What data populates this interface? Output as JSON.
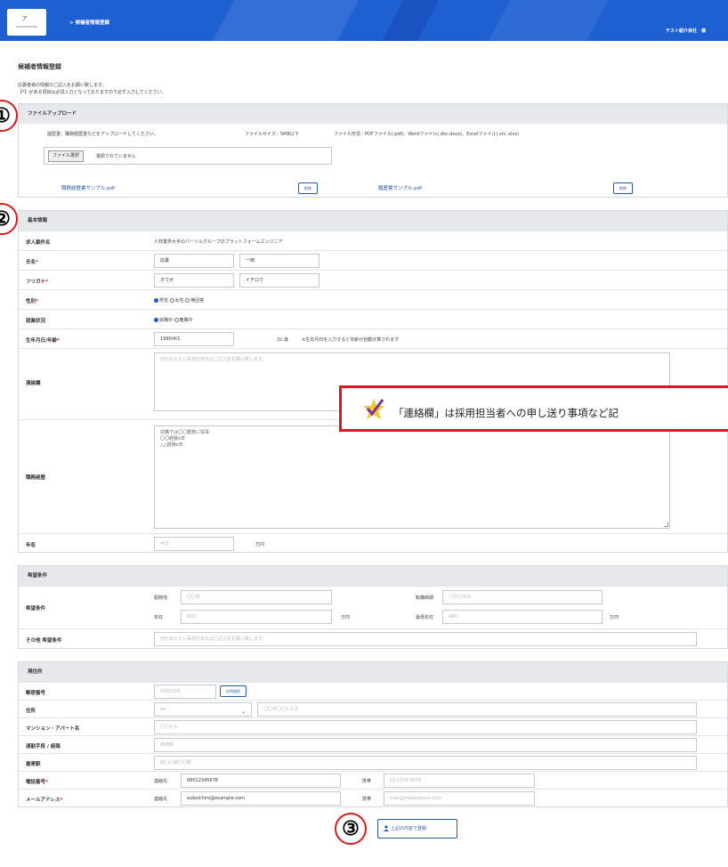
{
  "header": {
    "logo_text": "ア",
    "breadcrumb": "> 候補者情報登録",
    "company": "テスト紹介会社　様"
  },
  "page": {
    "title": "候補者情報登録",
    "intro_line1": "応募者様の情報のご記入をお願い致します。",
    "intro_line2": "【*】がある項目は必須入力となっておりますので必ず入力してください。"
  },
  "markers": [
    "①",
    "②",
    "③"
  ],
  "upload": {
    "section_title": "ファイルアップロード",
    "instruction": "履歴書、職務経歴書などをアップロードしてください。",
    "size_limit": "ファイルサイズ：5MB以下",
    "formats": "ファイル形式：PDFファイル(.pdf)、Wordファイル(.doc.docx)、Excelファイル(.xls .xlsx)",
    "choose_button": "ファイル選択",
    "no_file_text": "選択されていません",
    "files": [
      {
        "name": "職務経歴書サンプル.pdf",
        "delete_label": "削除"
      },
      {
        "name": "履歴書サンプル.pdf",
        "delete_label": "削除"
      }
    ]
  },
  "basic": {
    "section_title": "基本情報",
    "job_label": "求人案件名",
    "job_value": "人材業界大手のパーソルグループのプラットフォームエンジニア",
    "name_label": "氏名",
    "last_name": "応募",
    "first_name": "一郎",
    "kana_label": "フリガナ",
    "last_kana": "オウボ",
    "first_kana": "イチロウ",
    "gender_label": "性別",
    "gender_options": [
      "男性",
      "女性",
      "無回答"
    ],
    "gender_selected": "男性",
    "employment_label": "就業状況",
    "employment_options": [
      "就職中",
      "離職中"
    ],
    "employment_selected": "就職中",
    "birth_label": "生年月日/年齢",
    "birth_value": "1990/4/1",
    "age_value": "32",
    "age_unit": "歳",
    "age_note": "※生年月日を入力すると年齢が自動計算されます",
    "contact_label": "連絡欄",
    "contact_placeholder": "何か伝えたい事項があればご記入をお願い致します。",
    "career_label": "職務経歴",
    "career_lines": [
      "前職では〇〇業務に従事",
      "〇〇経験x年",
      "△△経験x年"
    ],
    "income_label": "年収",
    "income_placeholder": "400",
    "income_unit": "万円"
  },
  "callout": {
    "text": "「連絡欄」は採用担当者への申し送り事項など記"
  },
  "desired": {
    "section_title": "希望条件",
    "label": "希望条件",
    "pref_label": "勤務地",
    "pref_placeholder": "〇〇県",
    "start_label": "転職時期",
    "start_placeholder": "〇月〇日頃",
    "salary_label": "年収",
    "salary_placeholder": "600",
    "salary_unit": "万円",
    "min_salary_label": "最低年収",
    "min_salary_placeholder": "400",
    "min_salary_unit": "万円",
    "other_label": "その他 希望条件",
    "other_placeholder": "何か伝えたい事項があればご記入をお願い致します。"
  },
  "address": {
    "section_title": "現住所",
    "zip_label": "郵便番号",
    "zip_placeholder": "0000328",
    "zip_search_button": "住所検索",
    "address_label": "住所",
    "prefecture_value": "---",
    "address_placeholder": "〇〇市〇〇1-2-3",
    "building_label": "マンション・アパート名",
    "building_placeholder": "〇〇ビル",
    "commute_label": "通勤手段 / 経路",
    "commute_placeholder": "新宿駅",
    "station_label": "最寄駅",
    "station_placeholder": "JR〇〇線〇〇駅",
    "phone_label": "電話番号",
    "phone_contact_label": "連絡先",
    "phone_value": "08012345678",
    "phone_other_label": "携帯",
    "phone_other_placeholder": "03-1234-5678",
    "email_label": "メールアドレス",
    "email_contact_label": "連絡先",
    "email_value": "ouboichiro@example.com",
    "email_other_label": "携帯",
    "email_other_placeholder": "mail@mailaddress.com"
  },
  "submit": {
    "label": "上記の内容で登録"
  }
}
